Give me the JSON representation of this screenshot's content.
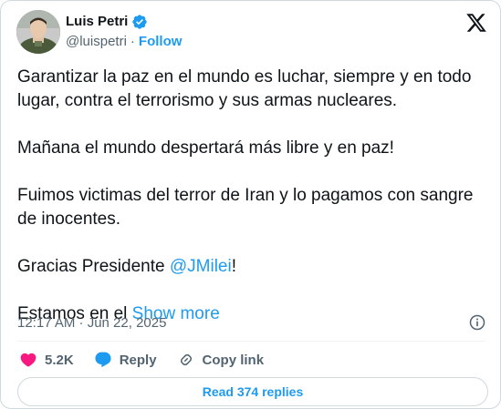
{
  "author": {
    "display_name": "Luis Petri",
    "handle": "@luispetri",
    "separator": "·",
    "follow_label": "Follow"
  },
  "tweet": {
    "paragraphs": [
      "Garantizar la paz en el mundo es luchar, siempre y en todo lugar, contra el terrorismo y sus armas nucleares.",
      "Mañana el mundo despertará más libre y en paz!",
      "Fuimos victimas del terror de Iran y lo pagamos con sangre de inocentes."
    ],
    "thanks_prefix": "Gracias Presidente ",
    "mention": "@JMilei",
    "thanks_suffix": "!",
    "last_prefix": "Estamos en el ",
    "show_more": "Show more"
  },
  "meta": {
    "timestamp": "12:17 AM · Jun 22, 2025"
  },
  "actions": {
    "likes": "5.2K",
    "reply_label": "Reply",
    "copy_link_label": "Copy link"
  },
  "replies_button": "Read 374 replies",
  "colors": {
    "accent": "#1d9bf0",
    "like": "#f91880",
    "text": "#0f1419",
    "muted": "#536471"
  },
  "icons": [
    "verified-badge-icon",
    "x-logo-icon",
    "info-icon",
    "heart-icon",
    "reply-bubble-icon",
    "link-icon"
  ]
}
